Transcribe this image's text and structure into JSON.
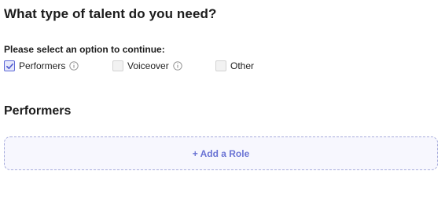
{
  "question": {
    "title": "What type of talent do you need?"
  },
  "prompt": {
    "label": "Please select an option to continue:"
  },
  "talent_options": [
    {
      "label": "Performers",
      "checked": true,
      "has_info": true
    },
    {
      "label": "Voiceover",
      "checked": false,
      "has_info": true
    },
    {
      "label": "Other",
      "checked": false,
      "has_info": false
    }
  ],
  "section": {
    "heading": "Performers",
    "add_role_label": "+ Add a Role"
  },
  "colors": {
    "accent": "#6a73d4",
    "check_border": "#5d69d6",
    "dashed_border": "#a7acdc",
    "add_role_bg": "#f7f7fe"
  },
  "icons": {
    "check": "checkmark-icon",
    "info": "info-circle-icon"
  }
}
